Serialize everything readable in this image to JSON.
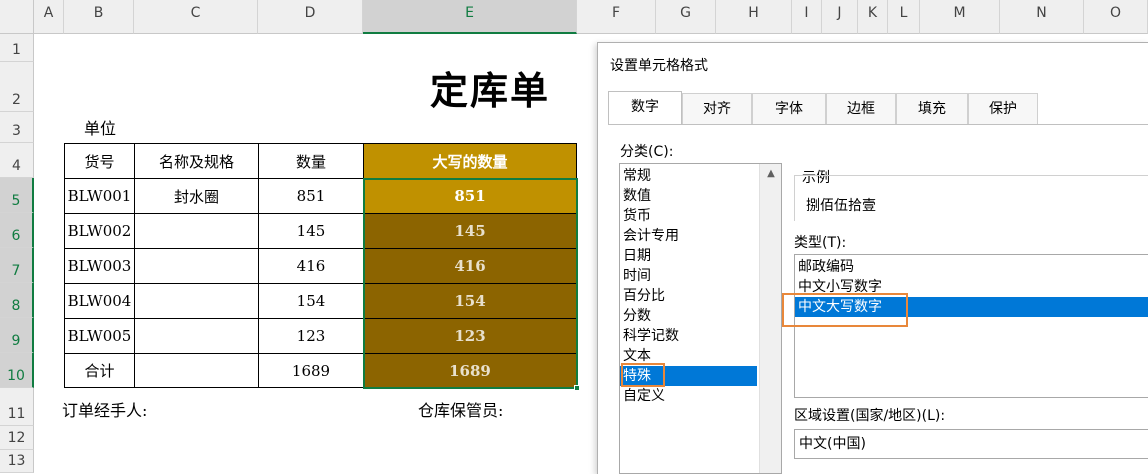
{
  "columns": [
    "A",
    "B",
    "C",
    "D",
    "E",
    "F",
    "G",
    "H",
    "I",
    "J",
    "K",
    "L",
    "M",
    "N",
    "O"
  ],
  "rows": [
    "1",
    "2",
    "3",
    "4",
    "5",
    "6",
    "7",
    "8",
    "9",
    "10",
    "11",
    "12",
    "13"
  ],
  "sheet": {
    "title": "定库单",
    "unit_label": "单位",
    "headers": [
      "货号",
      "名称及规格",
      "数量",
      "大写的数量"
    ],
    "data_rows": [
      {
        "code": "BLW001",
        "name": "封水圈",
        "qty": "851",
        "upper": "851"
      },
      {
        "code": "BLW002",
        "name": "",
        "qty": "145",
        "upper": "145"
      },
      {
        "code": "BLW003",
        "name": "",
        "qty": "416",
        "upper": "416"
      },
      {
        "code": "BLW004",
        "name": "",
        "qty": "154",
        "upper": "154"
      },
      {
        "code": "BLW005",
        "name": "",
        "qty": "123",
        "upper": "123"
      }
    ],
    "total": {
      "label": "合计",
      "qty": "1689",
      "upper": "1689"
    },
    "order_handler": "订单经手人:",
    "warehouse_keeper": "仓库保管员:"
  },
  "dialog": {
    "title": "设置单元格格式",
    "tabs": [
      "数字",
      "对齐",
      "字体",
      "边框",
      "填充",
      "保护"
    ],
    "category_label": "分类(C):",
    "categories": [
      "常规",
      "数值",
      "货币",
      "会计专用",
      "日期",
      "时间",
      "百分比",
      "分数",
      "科学记数",
      "文本",
      "特殊",
      "自定义"
    ],
    "selected_category": "特殊",
    "sample_label": "示例",
    "sample_value": "捌佰伍拾壹",
    "type_label": "类型(T):",
    "types": [
      "邮政编码",
      "中文小写数字",
      "中文大写数字"
    ],
    "selected_type": "中文大写数字",
    "locale_label": "区域设置(国家/地区)(L):",
    "locale_value": "中文(中国)"
  },
  "colors": {
    "header_gold": "#c09100",
    "data_dark": "#8c6400",
    "selection": "#0078d7",
    "highlight": "#e8873a",
    "excel_green": "#107c41"
  }
}
